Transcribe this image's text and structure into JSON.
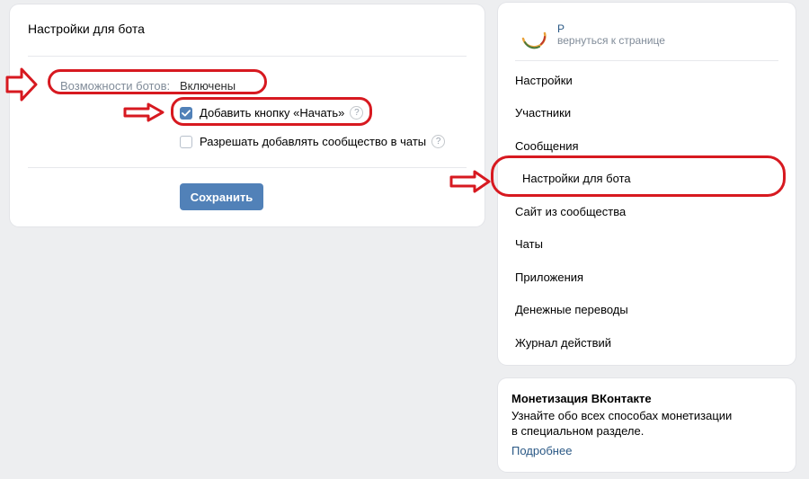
{
  "colors": {
    "accent": "#5181b8",
    "link": "#2a5885",
    "annotation": "#d71920"
  },
  "main": {
    "title": "Настройки для бота",
    "capabilities_label": "Возможности ботов:",
    "capabilities_value": "Включены",
    "option_start_button": {
      "label": "Добавить кнопку «Начать»",
      "checked": true
    },
    "option_allow_chats": {
      "label": "Разрешать добавлять сообщество в чаты",
      "checked": false
    },
    "help_glyph": "?",
    "save_label": "Сохранить"
  },
  "sidebar": {
    "group_name": "Р",
    "back_link": "вернуться к странице",
    "items": [
      {
        "label": "Настройки"
      },
      {
        "label": "Участники"
      },
      {
        "label": "Сообщения"
      },
      {
        "label": "Настройки для бота",
        "selected": true
      },
      {
        "label": "Сайт из сообщества"
      },
      {
        "label": "Чаты"
      },
      {
        "label": "Приложения"
      },
      {
        "label": "Денежные переводы"
      },
      {
        "label": "Журнал действий"
      }
    ]
  },
  "monetization": {
    "title": "Монетизация ВКонтакте",
    "text_line1": "Узнайте обо всех способах монетизации",
    "text_line2": "в специальном разделе.",
    "link": "Подробнее"
  },
  "icons": {
    "checkbox_checked": "checkmark-icon",
    "help": "question-icon",
    "annotation_arrow": "arrow-right-icon",
    "avatar": "community-avatar"
  }
}
